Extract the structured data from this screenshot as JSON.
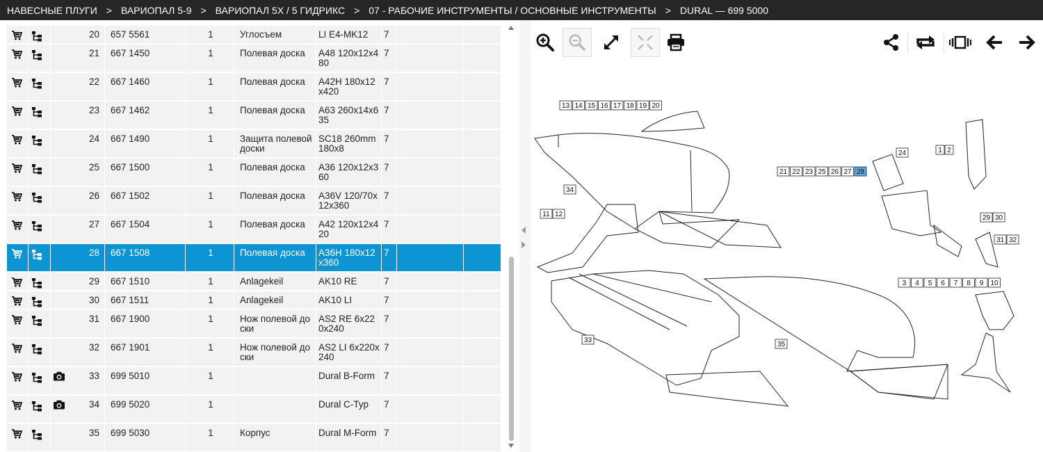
{
  "breadcrumb": [
    "НАВЕСНЫЕ ПЛУГИ",
    "ВАРИОПАЛ 5-9",
    "ВАРИОПАЛ 5Х / 5 ГИДРИКС",
    "07 - РАБОЧИЕ ИНСТРУМЕНТЫ / ОСНОВНЫЕ ИНСТРУМЕНТЫ",
    "DURAL — 699 5000"
  ],
  "breadcrumb_separator": ">",
  "colors": {
    "selected_row": "#0d94d3",
    "topbar": "#262626",
    "row": "#f2f2f2",
    "callout_highlight": "#5aa9e6"
  },
  "parts": [
    {
      "pos": "20",
      "number": "657 5561",
      "qty": "1",
      "name": "Углосъем",
      "code": "LI E4-MK12",
      "ver": "7",
      "camera": false,
      "selected": false
    },
    {
      "pos": "21",
      "number": "667 1450",
      "qty": "1",
      "name": "Полевая доска",
      "code": "A48 120x12x480",
      "ver": "7",
      "camera": false,
      "selected": false
    },
    {
      "pos": "22",
      "number": "667 1460",
      "qty": "1",
      "name": "Полевая доска",
      "code": "A42H 180x12x420",
      "ver": "7",
      "camera": false,
      "selected": false
    },
    {
      "pos": "23",
      "number": "667 1462",
      "qty": "1",
      "name": "Полевая доска",
      "code": "A63 260x14x635",
      "ver": "7",
      "camera": false,
      "selected": false
    },
    {
      "pos": "24",
      "number": "667 1490",
      "qty": "1",
      "name": "Защита полевой доски",
      "code": "SC18 260mm 180x8",
      "ver": "7",
      "camera": false,
      "selected": false
    },
    {
      "pos": "25",
      "number": "667 1500",
      "qty": "1",
      "name": "Полевая доска",
      "code": "A36 120x12x360",
      "ver": "7",
      "camera": false,
      "selected": false
    },
    {
      "pos": "26",
      "number": "667 1502",
      "qty": "1",
      "name": "Полевая доска",
      "code": "A36V 120/70x12x360",
      "ver": "7",
      "camera": false,
      "selected": false
    },
    {
      "pos": "27",
      "number": "667 1504",
      "qty": "1",
      "name": "Полевая доска",
      "code": "A42 120x12x420",
      "ver": "7",
      "camera": false,
      "selected": false
    },
    {
      "pos": "28",
      "number": "667 1508",
      "qty": "1",
      "name": "Полевая доска",
      "code": "A36H 180x12x360",
      "ver": "7",
      "camera": false,
      "selected": true
    },
    {
      "pos": "29",
      "number": "667 1510",
      "qty": "1",
      "name": "Anlagekeil",
      "code": "AK10 RE",
      "ver": "7",
      "camera": false,
      "selected": false
    },
    {
      "pos": "30",
      "number": "667 1511",
      "qty": "1",
      "name": "Anlagekeil",
      "code": "AK10 LI",
      "ver": "7",
      "camera": false,
      "selected": false
    },
    {
      "pos": "31",
      "number": "667 1900",
      "qty": "1",
      "name": "Нож полевой доски",
      "code": "AS2 RE 6x220x240",
      "ver": "7",
      "camera": false,
      "selected": false
    },
    {
      "pos": "32",
      "number": "667 1901",
      "qty": "1",
      "name": "Нож полевой доски",
      "code": "AS2 LI 6x220x240",
      "ver": "7",
      "camera": false,
      "selected": false
    },
    {
      "pos": "33",
      "number": "699 5010",
      "qty": "1",
      "name": "",
      "code": "Dural B-Form",
      "ver": "7",
      "camera": true,
      "selected": false
    },
    {
      "pos": "34",
      "number": "699 5020",
      "qty": "1",
      "name": "",
      "code": "Dural C-Typ",
      "ver": "7",
      "camera": true,
      "selected": false
    },
    {
      "pos": "35",
      "number": "699 5030",
      "qty": "1",
      "name": "Корпус",
      "code": "Dural M-Form",
      "ver": "7",
      "camera": false,
      "selected": false
    }
  ],
  "toolbar": {
    "left": [
      "zoom-in-icon",
      "zoom-out-icon",
      "fullscreen-icon",
      "fit-icon",
      "print-icon"
    ],
    "right": [
      "share-icon",
      "repeat-icon",
      "carousel-icon",
      "arrow-left-icon",
      "arrow-right-icon"
    ]
  },
  "callouts": {
    "g13": [
      "13",
      "14",
      "15",
      "16",
      "17",
      "18",
      "19",
      "20"
    ],
    "g21": [
      "21",
      "22",
      "23",
      "25",
      "26",
      "27",
      "28"
    ],
    "g3": [
      "3",
      "4",
      "5",
      "6",
      "7",
      "8",
      "9",
      "10"
    ],
    "c24": "24",
    "c1": "1",
    "c2": "2",
    "c34": "34",
    "c11": "11",
    "c12": "12",
    "c29": "29",
    "c30": "30",
    "c31": "31",
    "c32": "32",
    "c33": "33",
    "c35": "35",
    "highlighted": "28"
  }
}
